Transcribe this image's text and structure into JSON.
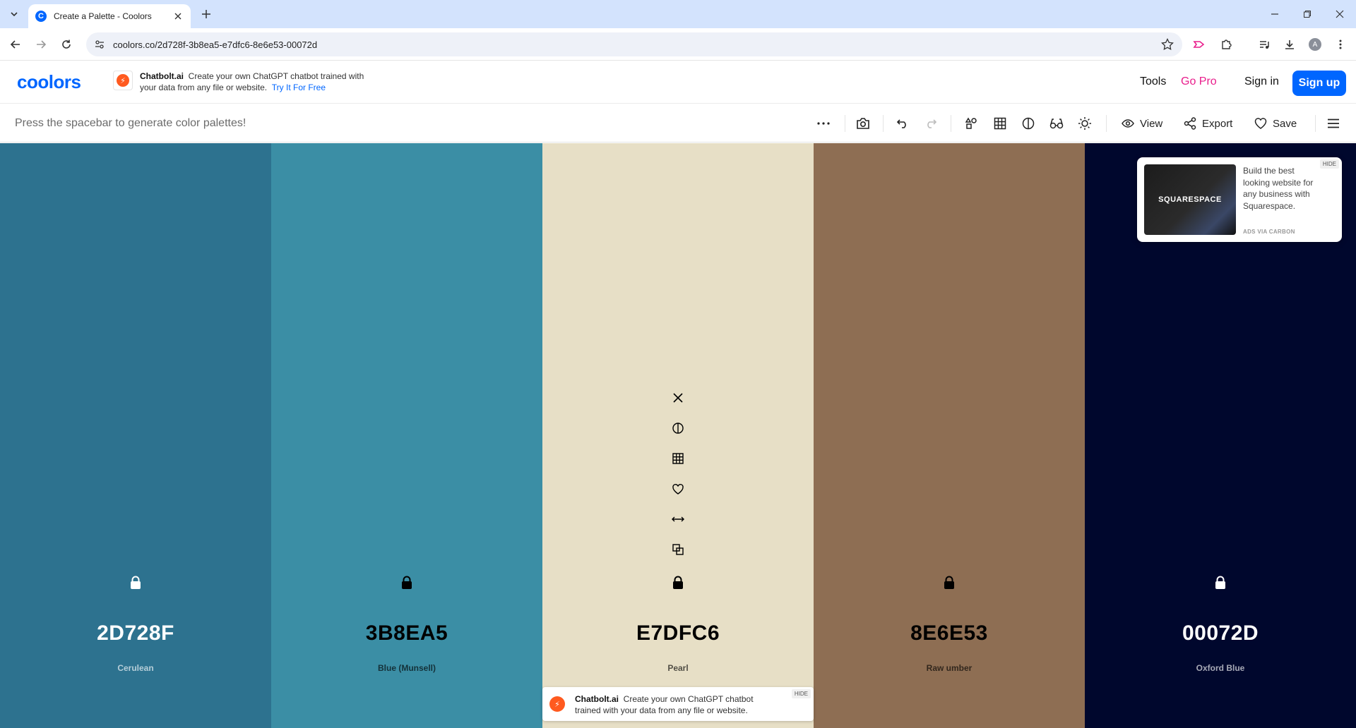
{
  "browser": {
    "tab_title": "Create a Palette - Coolors",
    "favicon_letter": "C",
    "url": "coolors.co/2d728f-3b8ea5-e7dfc6-8e6e53-00072d",
    "avatar_letter": "A"
  },
  "header": {
    "logo": "coolors",
    "promo": {
      "brand": "Chatbolt.ai",
      "text": "Create your own ChatGPT chatbot trained with your data from any file or website.",
      "cta": "Try It For Free"
    },
    "nav": {
      "tools": "Tools",
      "go_pro": "Go Pro",
      "sign_in": "Sign in",
      "sign_up": "Sign up"
    }
  },
  "toolbar": {
    "hint": "Press the spacebar to generate color palettes!",
    "view_label": "View",
    "export_label": "Export",
    "save_label": "Save"
  },
  "palette": [
    {
      "hex": "2D728F",
      "name": "Cerulean",
      "color": "#2d728f",
      "text_color": "#ffffff"
    },
    {
      "hex": "3B8EA5",
      "name": "Blue (Munsell)",
      "color": "#3b8ea5",
      "text_color": "#000000"
    },
    {
      "hex": "E7DFC6",
      "name": "Pearl",
      "color": "#e7dfc6",
      "text_color": "#000000"
    },
    {
      "hex": "8E6E53",
      "name": "Raw umber",
      "color": "#8e6e53",
      "text_color": "#000000"
    },
    {
      "hex": "00072D",
      "name": "Oxford Blue",
      "color": "#00072d",
      "text_color": "#ffffff"
    }
  ],
  "swatch_tools": [
    "close-icon",
    "contrast-icon",
    "grid-icon",
    "heart-icon",
    "drag-icon",
    "copy-icon"
  ],
  "carbon_ad": {
    "image_text": "SQUARESPACE",
    "text": "Build the best looking website for any business with Squarespace.",
    "via": "ADS VIA CARBON",
    "hide": "HIDE"
  },
  "bottom_ad": {
    "brand": "Chatbolt.ai",
    "text": "Create your own ChatGPT chatbot trained with your data from any file or website.",
    "hide": "HIDE",
    "icon_letter": "⚡"
  }
}
